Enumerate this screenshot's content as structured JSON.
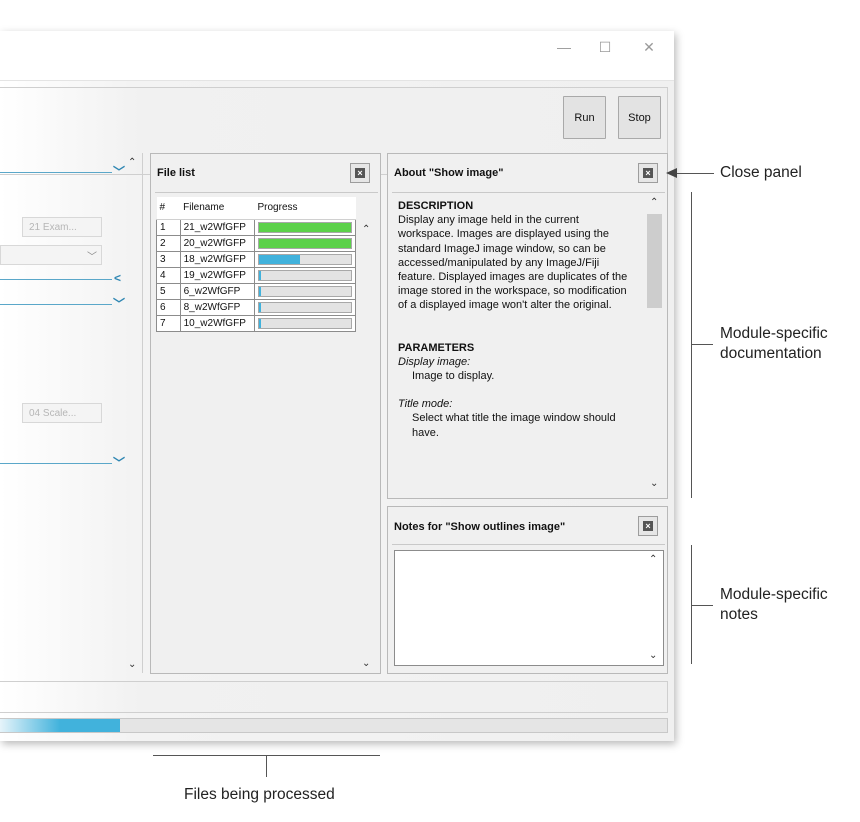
{
  "toolbar": {
    "run_label": "Run",
    "stop_label": "Stop"
  },
  "modules": {
    "button_1_label": "21 Exam...",
    "button_2_label": "04 Scale..."
  },
  "file_list": {
    "title": "File list",
    "columns": [
      "#",
      "Filename",
      "Progress"
    ],
    "rows": [
      {
        "num": "1",
        "filename": "21_w2WfGFP",
        "progress": 1.0
      },
      {
        "num": "2",
        "filename": "20_w2WfGFP",
        "progress": 1.0
      },
      {
        "num": "3",
        "filename": "18_w2WfGFP",
        "progress": 0.45
      },
      {
        "num": "4",
        "filename": "19_w2WfGFP",
        "progress": 0.02
      },
      {
        "num": "5",
        "filename": "6_w2WfGFP",
        "progress": 0.02
      },
      {
        "num": "6",
        "filename": "8_w2WfGFP",
        "progress": 0.02
      },
      {
        "num": "7",
        "filename": "10_w2WfGFP",
        "progress": 0.02
      }
    ]
  },
  "about": {
    "title": "About \"Show image\"",
    "description_heading": "DESCRIPTION",
    "description": "Display any image held in the current workspace. Images are displayed using the standard ImageJ image window, so can be accessed/manipulated by any ImageJ/Fiji feature. Displayed images are duplicates of the image stored in the workspace, so modification of a displayed image won't alter the original.",
    "parameters_heading": "PARAMETERS",
    "param_1_name": "Display image",
    "param_1_desc": "Image to display.",
    "param_2_name": "Title mode",
    "param_2_desc": "Select what title the image window should have."
  },
  "notes": {
    "title": "Notes for \"Show outlines image\"",
    "value": ""
  },
  "overall_progress": 0.18,
  "annotations": {
    "close_panel": "Close panel",
    "module_docs_line1": "Module-specific",
    "module_docs_line2": "documentation",
    "module_notes_line1": "Module-specific",
    "module_notes_line2": "notes",
    "files_processed": "Files being processed"
  },
  "colors": {
    "progress_done": "#5cd14a",
    "progress_active": "#41b2dc",
    "accent": "#2e86b2"
  }
}
